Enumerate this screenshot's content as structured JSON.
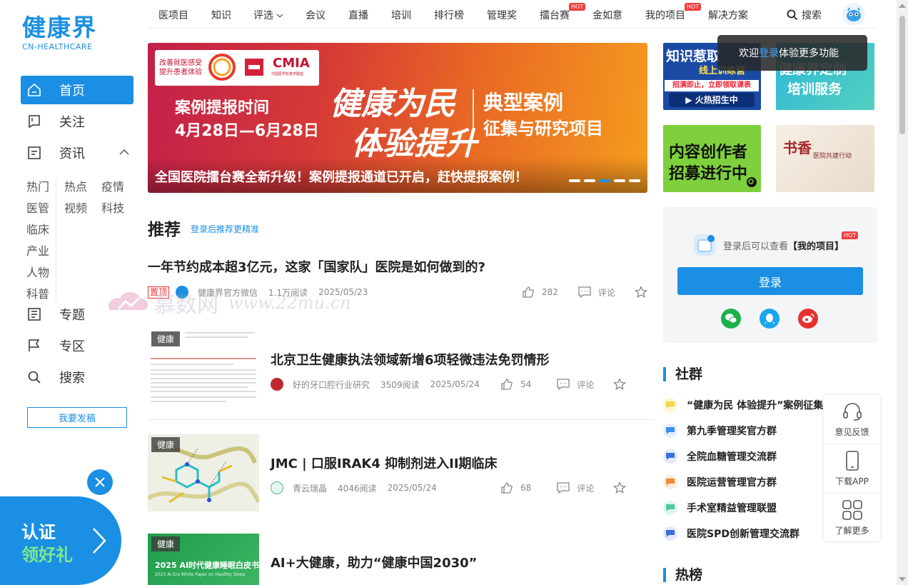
{
  "brand": {
    "name_zh": "健康界",
    "name_en": "CN-HEALTHCARE",
    "color": "#1a8fe3"
  },
  "sidebar": {
    "items": [
      {
        "label": "首页",
        "icon": "home-icon",
        "active": true
      },
      {
        "label": "关注",
        "icon": "bookmark-icon"
      },
      {
        "label": "资讯",
        "icon": "news-icon",
        "expanded": true
      }
    ],
    "sub_left": [
      "热门",
      "医管",
      "临床",
      "产业",
      "人物",
      "科普"
    ],
    "sub_right": [
      "热点",
      "视频"
    ],
    "sub_third": [
      "疫情",
      "科技"
    ],
    "items2": [
      {
        "label": "专题",
        "icon": "topic-icon"
      },
      {
        "label": "专区",
        "icon": "flag-icon"
      },
      {
        "label": "搜索",
        "icon": "search-icon"
      }
    ],
    "post_button": "我要发稿",
    "cert": {
      "line1": "认证",
      "line2": "领好礼"
    }
  },
  "topnav": {
    "items": [
      "医项目",
      "知识",
      "评选",
      "会议",
      "直播",
      "培训",
      "排行榜",
      "管理奖",
      "擂台赛",
      "金如意",
      "我的项目",
      "解决方案"
    ],
    "hot_badge": "HOT",
    "search": "搜索"
  },
  "tooltip": {
    "before": "欢迎",
    "link": "登录",
    "after": "体验更多功能"
  },
  "banner": {
    "org_line1": "改善就医感受",
    "org_line2": "提升患者体验",
    "org_cmia": "CMIA",
    "org_cmia_sub": "中国医学影像学联盟",
    "period_label": "案例提报时间",
    "period_dates": "4月28日—6月28日",
    "callig1": "健康为民",
    "callig2": "体验提升",
    "right1": "典型案例",
    "right2": "征集与研究项目",
    "caption": "全国医院擂台赛全新升级！案例提报通道已开启，赶快提报案例！",
    "dots": 5,
    "active_dot": 2
  },
  "tiles": {
    "zhishi": {
      "a": "知识惹取",
      "b": "线上训练营",
      "c": "招满即止，立即领取课表",
      "d": "▶ 火热招生中"
    },
    "peixun": {
      "a": "健康界定制",
      "b": "培训服务"
    },
    "neirong": {
      "a": "内容创作者",
      "b": "招募进行中"
    },
    "shuxiang": {
      "a": "书香",
      "b": "医院共建行动"
    }
  },
  "feed": {
    "title": "推荐",
    "subtitle": "登录后推荐更精准",
    "top_article": {
      "title": "一年节约成本超3亿元，这家「国家队」医院是如何做到的?",
      "tag": "置顶",
      "source": "健康界官方微信",
      "reads": "1.1万阅读",
      "date": "2025/05/23",
      "likes": "282",
      "comment": "评论"
    },
    "articles": [
      {
        "tag": "健康",
        "title": "北京卫生健康执法领域新增6项轻微违法免罚情形",
        "source": "好的牙口腔行业研究",
        "reads": "3509阅读",
        "date": "2025/05/24",
        "likes": "54",
        "comment": "评论"
      },
      {
        "tag": "健康",
        "title": "JMC | 口服IRAK4 抑制剂进入II期临床",
        "source": "青云瑞晶",
        "reads": "4046阅读",
        "date": "2025/05/24",
        "likes": "68",
        "comment": "评论"
      },
      {
        "tag": "健康",
        "title": "AI+大健康，助力“健康中国2030”",
        "thumb_text": "2025 AI时代健康睡眠白皮书",
        "thumb_sub": "2025 AI Era White Paper on Healthy Sleep"
      }
    ],
    "watermark": {
      "zh": "慕数网",
      "url": "www.22mu.cn"
    }
  },
  "login_card": {
    "hint_prefix": "登录后可以查看",
    "hint_bold": "【我的项目】",
    "hot": "HOT",
    "button": "登录",
    "social": [
      "wechat-icon",
      "qq-icon",
      "weibo-icon"
    ]
  },
  "community": {
    "title": "社群",
    "groups": [
      {
        "name": "“健康为民 体验提升”案例征集",
        "color": "#f5d54a"
      },
      {
        "name": "第九季管理奖官方群",
        "color": "#3a8ee8"
      },
      {
        "name": "全院血糖管理交流群",
        "color": "#3a6fe0"
      },
      {
        "name": "医院运营管理官方群",
        "color": "#f08a3a"
      },
      {
        "name": "手术室精益管理联盟",
        "color": "#4ec9a0"
      },
      {
        "name": "医院SPD创新管理交流群",
        "color": "#3a6fe0"
      }
    ]
  },
  "hot_list": {
    "title": "热榜"
  },
  "float_bar": [
    "意见反馈",
    "下载APP",
    "了解更多"
  ]
}
